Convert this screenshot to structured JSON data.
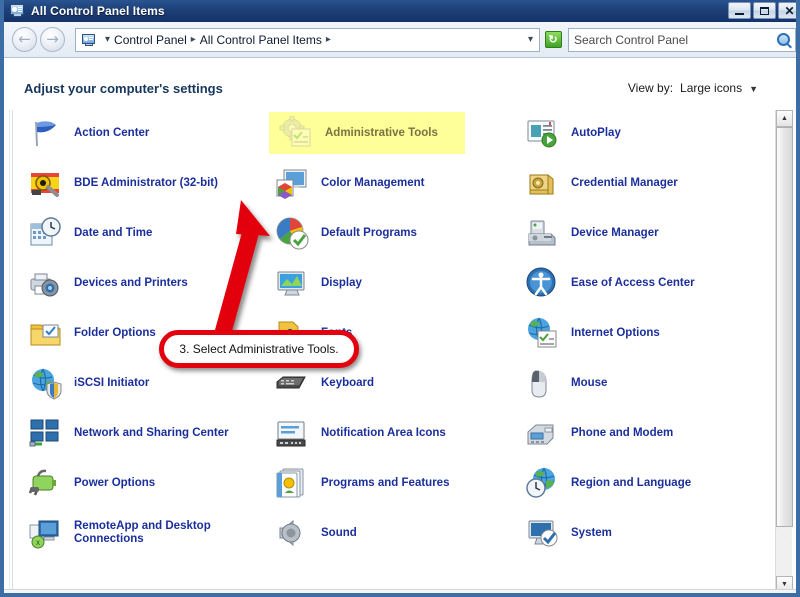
{
  "window": {
    "title": "All Control Panel Items",
    "title_icon": "control-panel-icon",
    "minimize_label": "–",
    "maximize_label": "□",
    "close_label": "✕"
  },
  "addressbar": {
    "back_glyph": "←",
    "forward_glyph": "→",
    "separator": "▸",
    "crumbs": [
      "Control Panel",
      "All Control Panel Items"
    ],
    "dropdown_caret": "▾",
    "refresh_glyph": "↻",
    "search": {
      "placeholder": "Search Control Panel",
      "value": ""
    }
  },
  "header": {
    "heading": "Adjust your computer's settings",
    "view_by_label": "View by:",
    "view_by_value": "Large icons",
    "view_by_caret": "▼"
  },
  "items": {
    "column1": [
      {
        "label": "Action Center",
        "icon": "flag-icon",
        "highlighted": false
      },
      {
        "label": "BDE Administrator (32-bit)",
        "icon": "bde-admin-icon",
        "highlighted": false
      },
      {
        "label": "Date and Time",
        "icon": "calendar-clock-icon",
        "highlighted": false
      },
      {
        "label": "Devices and Printers",
        "icon": "printer-camera-icon",
        "highlighted": false
      },
      {
        "label": "Folder Options",
        "icon": "folder-icon",
        "highlighted": false
      },
      {
        "label": "iSCSI Initiator",
        "icon": "globe-shield-icon",
        "highlighted": false
      },
      {
        "label": "Network and Sharing Center",
        "icon": "network-icon",
        "highlighted": false
      },
      {
        "label": "Power Options",
        "icon": "battery-plug-icon",
        "highlighted": false
      },
      {
        "label": "RemoteApp and Desktop Connections",
        "icon": "remoteapp-icon",
        "highlighted": false
      }
    ],
    "column2": [
      {
        "label": "Administrative Tools",
        "icon": "admin-tools-icon",
        "highlighted": true
      },
      {
        "label": "Color Management",
        "icon": "color-management-icon",
        "highlighted": false
      },
      {
        "label": "Default Programs",
        "icon": "default-programs-icon",
        "highlighted": false
      },
      {
        "label": "Display",
        "icon": "display-icon",
        "highlighted": false
      },
      {
        "label": "Fonts",
        "icon": "fonts-icon",
        "highlighted": false
      },
      {
        "label": "Keyboard",
        "icon": "keyboard-icon",
        "highlighted": false
      },
      {
        "label": "Notification Area Icons",
        "icon": "notification-area-icon",
        "highlighted": false
      },
      {
        "label": "Programs and Features",
        "icon": "programs-features-icon",
        "highlighted": false
      },
      {
        "label": "Sound",
        "icon": "speaker-icon",
        "highlighted": false
      }
    ],
    "column3": [
      {
        "label": "AutoPlay",
        "icon": "autoplay-icon",
        "highlighted": false
      },
      {
        "label": "Credential Manager",
        "icon": "credential-manager-icon",
        "highlighted": false
      },
      {
        "label": "Device Manager",
        "icon": "device-manager-icon",
        "highlighted": false
      },
      {
        "label": "Ease of Access Center",
        "icon": "ease-of-access-icon",
        "highlighted": false
      },
      {
        "label": "Internet Options",
        "icon": "internet-options-icon",
        "highlighted": false
      },
      {
        "label": "Mouse",
        "icon": "mouse-icon",
        "highlighted": false
      },
      {
        "label": "Phone and Modem",
        "icon": "phone-modem-icon",
        "highlighted": false
      },
      {
        "label": "Region and Language",
        "icon": "region-language-icon",
        "highlighted": false
      },
      {
        "label": "System",
        "icon": "system-icon",
        "highlighted": false
      }
    ]
  },
  "annotation": {
    "callout_text": "3. Select Administrative Tools.",
    "arrow": "red-arrow-up-right",
    "color": "#e3000f"
  },
  "scrollbar": {
    "up_glyph": "▲",
    "down_glyph": "▼"
  },
  "colors": {
    "titlebar": "#1d3f77",
    "label": "#1b2f9c",
    "heading": "#17365d",
    "highlight": "#ffff99",
    "annotation": "#e3000f",
    "window_frame": "#3c6ea5"
  }
}
